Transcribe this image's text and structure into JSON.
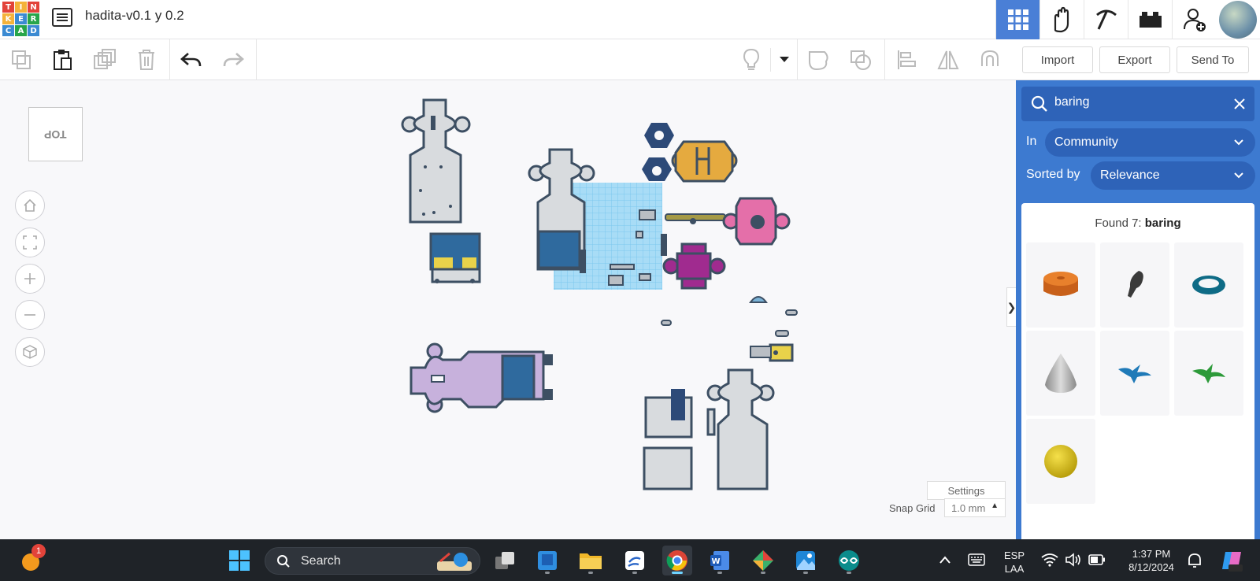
{
  "logo": {
    "letters": [
      "T",
      "I",
      "N",
      "K",
      "E",
      "R",
      "C",
      "A",
      "D"
    ],
    "colors": [
      "#e2433a",
      "#f4b23a",
      "#e2433a",
      "#f4b23a",
      "#3b8ad2",
      "#27a54a",
      "#3b8ad2",
      "#27a54a",
      "#3b8ad2"
    ]
  },
  "header": {
    "title": "hadita-v0.1 y 0.2"
  },
  "toolbar": {
    "import_label": "Import",
    "export_label": "Export",
    "send_to_label": "Send To"
  },
  "workplane": {
    "viewcube_face": "TOP",
    "settings_label": "Settings",
    "snap_grid_label": "Snap Grid",
    "snap_grid_value": "1.0 mm"
  },
  "panel": {
    "search_value": "baring",
    "in_label": "In",
    "in_value": "Community",
    "sorted_label": "Sorted by",
    "sorted_value": "Relevance",
    "found_prefix": "Found 7:",
    "found_term": "baring",
    "results": [
      {
        "name": "orange-cylinder",
        "icon": "cylinder-shape"
      },
      {
        "name": "dark-figure",
        "icon": "figure-shape"
      },
      {
        "name": "teal-ring",
        "icon": "ring-shape"
      },
      {
        "name": "gray-cone",
        "icon": "cone-shape"
      },
      {
        "name": "blue-bird",
        "icon": "bird-shape"
      },
      {
        "name": "green-bird",
        "icon": "bird-shape"
      },
      {
        "name": "yellow-sphere",
        "icon": "sphere-shape"
      }
    ]
  },
  "taskbar": {
    "search_label": "Search",
    "notification_count": "1",
    "lang_top": "ESP",
    "lang_bottom": "LAA",
    "time": "1:37 PM",
    "date": "8/12/2024"
  }
}
